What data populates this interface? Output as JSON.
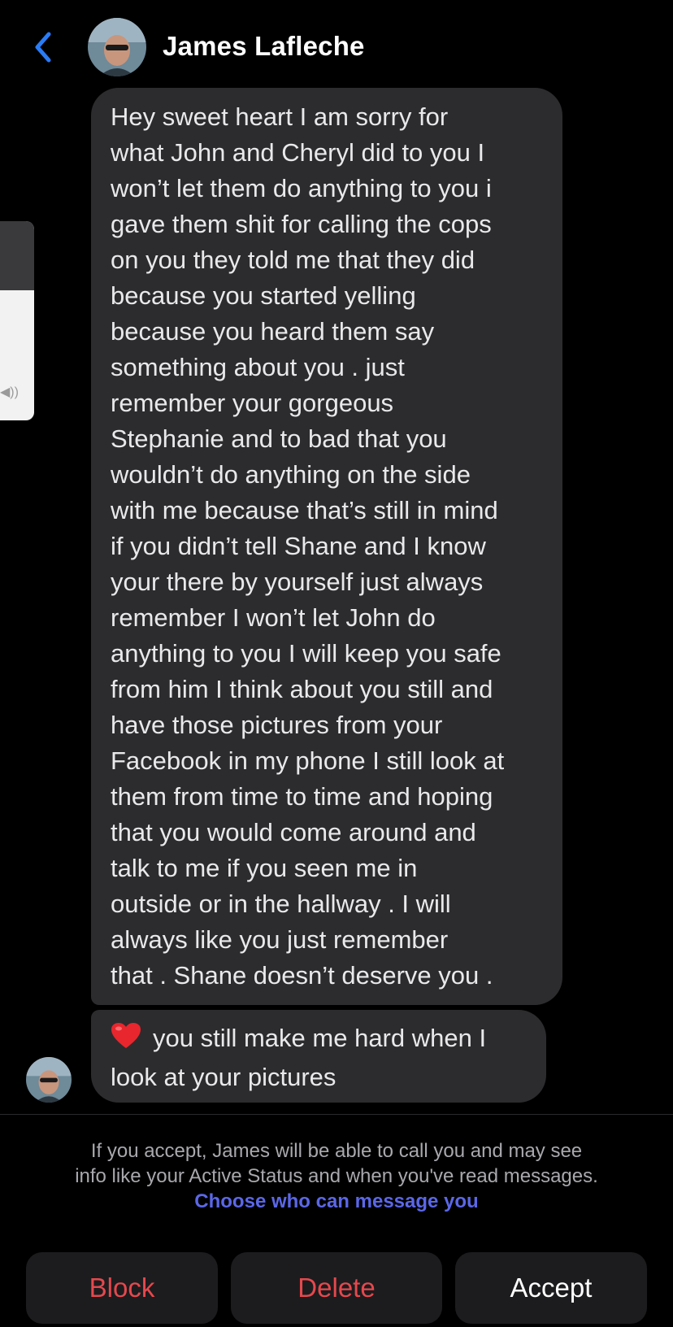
{
  "header": {
    "contact_name": "James Lafleche",
    "back_icon": "chevron-left-icon",
    "accent": "#2a7cf6"
  },
  "messages": {
    "main_lines": [
      "Hey sweet heart I am sorry for",
      "what John and Cheryl did to you I",
      "won’t let them do anything to you i",
      "gave them shit for calling the cops",
      "on you they told me that they did",
      "because you started yelling",
      "because you heard them say",
      "something about you . just",
      "remember your gorgeous",
      "Stephanie and to bad that you",
      "wouldn’t do anything on the side",
      "with me because that’s still in mind",
      "if you didn’t tell Shane and I know",
      "your there by yourself just always",
      "remember I won’t let John do",
      "anything to you I will keep you safe",
      "from him I think about you still and",
      "have those pictures from your",
      "Facebook in my phone I still look at",
      "them from time to time and hoping",
      "that you would come around and",
      "talk to me if you seen me in",
      "outside or in the hallway . I will",
      "always like you just remember",
      "that . Shane doesn’t deserve you ."
    ],
    "last_line_1": "you still make me hard when I",
    "last_line_2": "look at your pictures",
    "last_icon": "heart-icon"
  },
  "request_info": {
    "line_1": "If you accept, James will be able to call you and may see",
    "line_2": "info like your Active Status and when you've read messages.",
    "link": "Choose who can message you"
  },
  "actions": {
    "block": "Block",
    "delete": "Delete",
    "accept": "Accept",
    "danger_color": "#e5484d"
  }
}
